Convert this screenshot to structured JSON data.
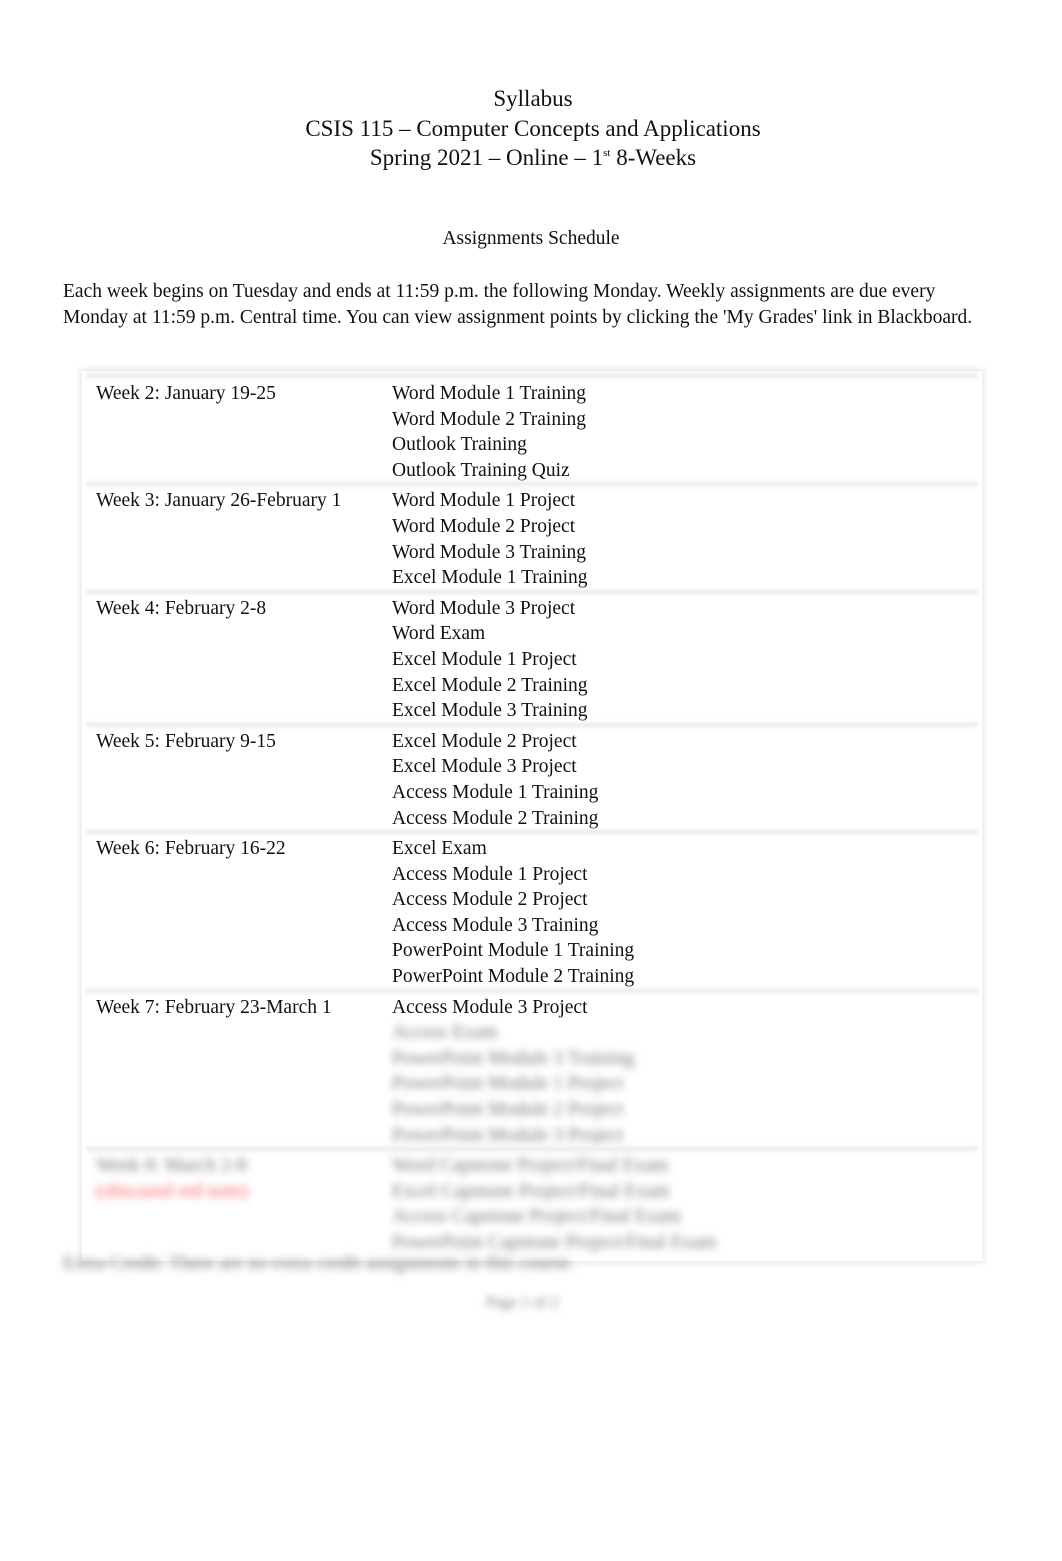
{
  "header": {
    "line1": "Syllabus",
    "line2": "CSIS 115 – Computer Concepts and Applications",
    "line3_prefix": "Spring 2021 – Online – 1",
    "line3_sup": "st",
    "line3_suffix": " 8-Weeks"
  },
  "section_title": "Assignments Schedule",
  "intro": "Each week begins on Tuesday and ends at 11:59 p.m. the following Monday. Weekly assignments are due every Monday at 11:59 p.m. Central time. You can view assignment points by clicking the 'My Grades' link in Blackboard.",
  "schedule": [
    {
      "week": "Week 2: January 19-25",
      "items": [
        "Word Module 1 Training",
        "Word Module 2 Training",
        "Outlook Training",
        "Outlook Training Quiz"
      ]
    },
    {
      "week": "Week 3: January 26-February 1",
      "items": [
        "Word Module 1 Project",
        "Word Module 2 Project",
        "Word Module 3 Training",
        "Excel Module 1 Training"
      ]
    },
    {
      "week": "Week 4: February 2-8",
      "items": [
        "Word Module 3 Project",
        "Word Exam",
        "Excel Module 1 Project",
        "Excel Module 2 Training",
        "Excel Module 3 Training"
      ]
    },
    {
      "week": "Week 5: February 9-15",
      "items": [
        "Excel Module 2 Project",
        "Excel Module 3 Project",
        "Access Module 1 Training",
        "Access Module 2 Training"
      ]
    },
    {
      "week": "Week 6: February 16-22",
      "items": [
        "Excel Exam",
        "Access Module 1 Project",
        "Access Module 2 Project",
        "Access Module 3 Training",
        "PowerPoint Module 1 Training",
        "PowerPoint Module 2 Training"
      ]
    },
    {
      "week": "Week 7: February 23-March 1",
      "items": [
        "Access Module 3 Project",
        "Access Exam",
        "PowerPoint Module 3 Training",
        "PowerPoint Module 1 Project",
        "PowerPoint Module 2 Project",
        "PowerPoint Module 3 Project"
      ]
    },
    {
      "week": "Week 8: March 2-8",
      "week_note": "(obscured red note)",
      "items": [
        "Word Capstone Project/Final Exam",
        "Excel Capstone Project/Final Exam",
        "Access Capstone Project/Final Exam",
        "PowerPoint Capstone Project/Final Exam"
      ]
    }
  ],
  "footer_note": "Extra Credit: There are no extra credit assignments in this course.",
  "page_number": "Page 1 of 2"
}
